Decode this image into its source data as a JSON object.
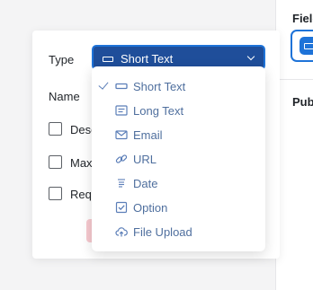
{
  "side_panel": {
    "title": "Field",
    "section": "Pub"
  },
  "form": {
    "type_label": "Type",
    "name_label": "Name",
    "checkboxes": [
      {
        "label": "Desc"
      },
      {
        "label": "Max"
      },
      {
        "label": "Requ"
      }
    ]
  },
  "select": {
    "value": "Short Text",
    "icon": "short-text-icon"
  },
  "dropdown": {
    "options": [
      {
        "label": "Short Text",
        "icon": "short-text-icon",
        "selected": true
      },
      {
        "label": "Long Text",
        "icon": "long-text-icon",
        "selected": false
      },
      {
        "label": "Email",
        "icon": "email-icon",
        "selected": false
      },
      {
        "label": "URL",
        "icon": "link-icon",
        "selected": false
      },
      {
        "label": "Date",
        "icon": "date-icon",
        "selected": false
      },
      {
        "label": "Option",
        "icon": "checkbox-icon",
        "selected": false
      },
      {
        "label": "File Upload",
        "icon": "cloud-upload-icon",
        "selected": false
      }
    ]
  },
  "colors": {
    "accent": "#1e73d8",
    "select_bg": "#1f4e9a",
    "option_text": "#4f6f9e"
  }
}
